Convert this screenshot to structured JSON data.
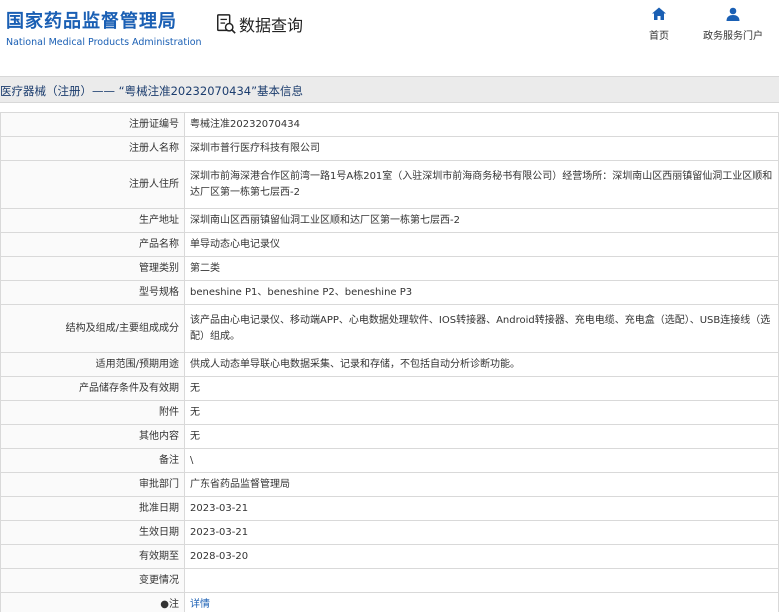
{
  "header": {
    "logo_cn": "国家药品监督管理局",
    "logo_en": "National Medical Products Administration",
    "query_label": "数据查询",
    "nav_home": "首页",
    "nav_service": "政务服务门户",
    "brand_color": "#1a5fb4"
  },
  "title": "医疗器械（注册）—— “粤械注准20232070434”基本信息",
  "rows": [
    {
      "label": "注册证编号",
      "value": "粤械注准20232070434"
    },
    {
      "label": "注册人名称",
      "value": "深圳市普行医疗科技有限公司"
    },
    {
      "label": "注册人住所",
      "value": "深圳市前海深港合作区前湾一路1号A栋201室（入驻深圳市前海商务秘书有限公司）经营场所：深圳南山区西丽镇留仙洞工业区顺和达厂区第一栋第七层西-2"
    },
    {
      "label": "生产地址",
      "value": "深圳南山区西丽镇留仙洞工业区顺和达厂区第一栋第七层西-2"
    },
    {
      "label": "产品名称",
      "value": "单导动态心电记录仪"
    },
    {
      "label": "管理类别",
      "value": "第二类"
    },
    {
      "label": "型号规格",
      "value": "beneshine P1、beneshine P2、beneshine P3"
    },
    {
      "label": "结构及组成/主要组成成分",
      "value": "该产品由心电记录仪、移动端APP、心电数据处理软件、IOS转接器、Android转接器、充电电缆、充电盒（选配）、USB连接线（选配）组成。"
    },
    {
      "label": "适用范围/预期用途",
      "value": "供成人动态单导联心电数据采集、记录和存储，不包括自动分析诊断功能。"
    },
    {
      "label": "产品储存条件及有效期",
      "value": "无"
    },
    {
      "label": "附件",
      "value": "无"
    },
    {
      "label": "其他内容",
      "value": "无"
    },
    {
      "label": "备注",
      "value": "\\"
    },
    {
      "label": "审批部门",
      "value": "广东省药品监督管理局"
    },
    {
      "label": "批准日期",
      "value": "2023-03-21"
    },
    {
      "label": "生效日期",
      "value": "2023-03-21"
    },
    {
      "label": "有效期至",
      "value": "2028-03-20"
    },
    {
      "label": "变更情况",
      "value": ""
    },
    {
      "label": "注",
      "value": "详情"
    }
  ]
}
